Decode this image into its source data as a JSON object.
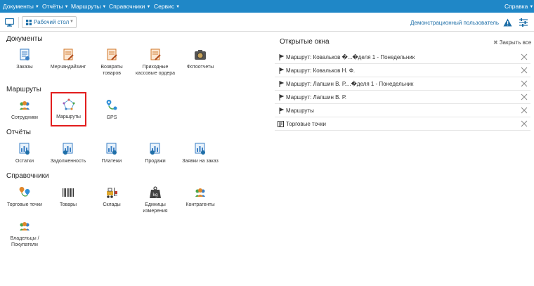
{
  "menu": {
    "items": [
      "Документы",
      "Отчёты",
      "Маршруты",
      "Справочники",
      "Сервис"
    ],
    "help": "Справка"
  },
  "toolbar": {
    "desktop_label": "Рабочий стол",
    "user": "Демонстрационный пользователь"
  },
  "sections": {
    "documents": {
      "title": "Документы",
      "items": [
        "Заказы",
        "Мерчандайзинг",
        "Возвраты товаров",
        "Приходные кассовые ордера",
        "Фотоотчеты"
      ]
    },
    "routes": {
      "title": "Маршруты",
      "items": [
        "Сотрудники",
        "Маршруты",
        "GPS"
      ]
    },
    "reports": {
      "title": "Отчёты",
      "items": [
        "Остатки",
        "Задолженность",
        "Платежи",
        "Продажи",
        "Заявки на заказ"
      ]
    },
    "references": {
      "title": "Справочники",
      "items": [
        "Торговые точки",
        "Товары",
        "Склады",
        "Единицы измерения",
        "Контрагенты",
        "Владельцы / Покупатели"
      ]
    }
  },
  "open_windows": {
    "title": "Открытые окна",
    "close_all": "Закрыть все",
    "items": [
      "Маршрут: Ковальков �...�деля 1 - Понедельник",
      "Маршрут: Ковальков Н. Ф.",
      "Маршрут: Лапшин В. Р....�деля 1 - Понедельник",
      "Маршрут: Лапшин В. Р.",
      "Маршруты",
      "Торговые точки"
    ]
  },
  "colors": {
    "menubar": "#1f87c7",
    "link": "#1f6fa8",
    "selection": "#e21d1d"
  }
}
